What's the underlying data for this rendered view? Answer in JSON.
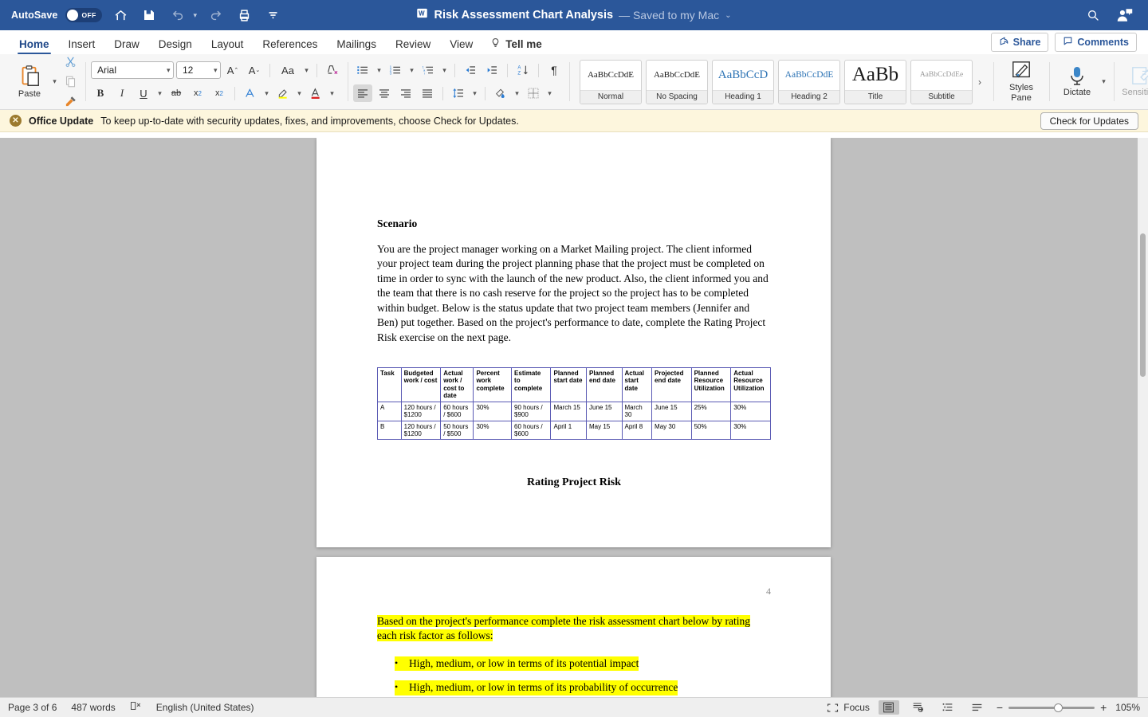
{
  "titlebar": {
    "autosave_label": "AutoSave",
    "autosave_state": "OFF",
    "doc_title": "Risk Assessment Chart Analysis",
    "saved_status": "— Saved to my Mac",
    "icons": [
      "home-icon",
      "save-icon",
      "undo-icon",
      "redo-icon",
      "print-icon",
      "customize-icon"
    ],
    "right_icons": [
      "search-icon",
      "account-icon"
    ]
  },
  "tabs": [
    {
      "label": "Home",
      "active": true
    },
    {
      "label": "Insert",
      "active": false
    },
    {
      "label": "Draw",
      "active": false
    },
    {
      "label": "Design",
      "active": false
    },
    {
      "label": "Layout",
      "active": false
    },
    {
      "label": "References",
      "active": false
    },
    {
      "label": "Mailings",
      "active": false
    },
    {
      "label": "Review",
      "active": false
    },
    {
      "label": "View",
      "active": false
    }
  ],
  "tellme": "Tell me",
  "share_label": "Share",
  "comments_label": "Comments",
  "ribbon": {
    "paste_label": "Paste",
    "font_name": "Arial",
    "font_size": "12",
    "styles": [
      {
        "preview": "AaBbCcDdE",
        "name": "Normal",
        "size": 11,
        "color": "#1a1a1a"
      },
      {
        "preview": "AaBbCcDdE",
        "name": "No Spacing",
        "size": 11,
        "color": "#1a1a1a"
      },
      {
        "preview": "AaBbCcD",
        "name": "Heading 1",
        "size": 15,
        "color": "#2e74b5"
      },
      {
        "preview": "AaBbCcDdE",
        "name": "Heading 2",
        "size": 11.5,
        "color": "#2e74b5"
      },
      {
        "preview": "AaBb",
        "name": "Title",
        "size": 24,
        "color": "#1a1a1a"
      },
      {
        "preview": "AaBbCcDdEe",
        "name": "Subtitle",
        "size": 9.5,
        "color": "#9a9a9a"
      }
    ],
    "gallery_more": "›",
    "styles_pane_label": "Styles\nPane",
    "styles_pane_line1": "Styles",
    "styles_pane_line2": "Pane",
    "dictate_label": "Dictate",
    "sensitivity_label": "Sensitivity"
  },
  "update_bar": {
    "title": "Office Update",
    "message": "To keep up-to-date with security updates, fixes, and improvements, choose Check for Updates.",
    "button": "Check for Updates"
  },
  "document": {
    "heading": "Scenario",
    "paragraph": "You are the project manager working on a Market Mailing project.  The client informed your project team during the project planning phase that the project must be completed on time in order to sync with the launch of the new product. Also, the client informed you and the team that there is no cash reserve for the project so the project has to be completed within budget.  Below is the status update that two project team members (Jennifer and Ben) put together.  Based on the project's performance to date, complete the Rating Project Risk exercise on the next page.",
    "subheading": "Rating Project Risk",
    "table": {
      "headers": [
        "Task",
        "Budgeted work / cost",
        "Actual work / cost to date",
        "Percent work complete",
        "Estimate to complete",
        "Planned start date",
        "Planned end date",
        "Actual start date",
        "Projected end date",
        "Planned Resource Utilization",
        "Actual Resource Utilization"
      ],
      "rows": [
        [
          "A",
          "120 hours / $1200",
          "60 hours / $600",
          "30%",
          "90 hours / $900",
          "March 15",
          "June 15",
          "March 30",
          "June 15",
          "25%",
          "30%"
        ],
        [
          "B",
          "120 hours / $1200",
          "50 hours / $500",
          "30%",
          "60 hours / $600",
          "April 1",
          "May 15",
          "April 8",
          "May 30",
          "50%",
          "30%"
        ]
      ]
    },
    "page2": {
      "page_number": "4",
      "intro": "Based on the project's performance complete the risk assessment chart below by rating each risk factor as follows:",
      "bullets": [
        "High, medium, or low in terms of its potential impact",
        "High, medium, or low in terms of its probability of occurrence"
      ],
      "bullet_marker": "•"
    }
  },
  "status_bar": {
    "page_info": "Page 3 of 6",
    "word_count": "487 words",
    "proofing_icon": "proofing-errors-icon",
    "language": "English (United States)",
    "focus_label": "Focus",
    "zoom_level": "105%",
    "zoom_minus": "−",
    "zoom_plus": "+",
    "view_buttons": [
      "print-layout-view",
      "web-layout-view",
      "outline-view",
      "draft-view"
    ]
  },
  "colors": {
    "titlebar": "#2b579a",
    "accent": "#2b579a",
    "highlight": "#ffff00",
    "table_border": "#5a5ab4",
    "update_bg": "#fdf6dd"
  }
}
